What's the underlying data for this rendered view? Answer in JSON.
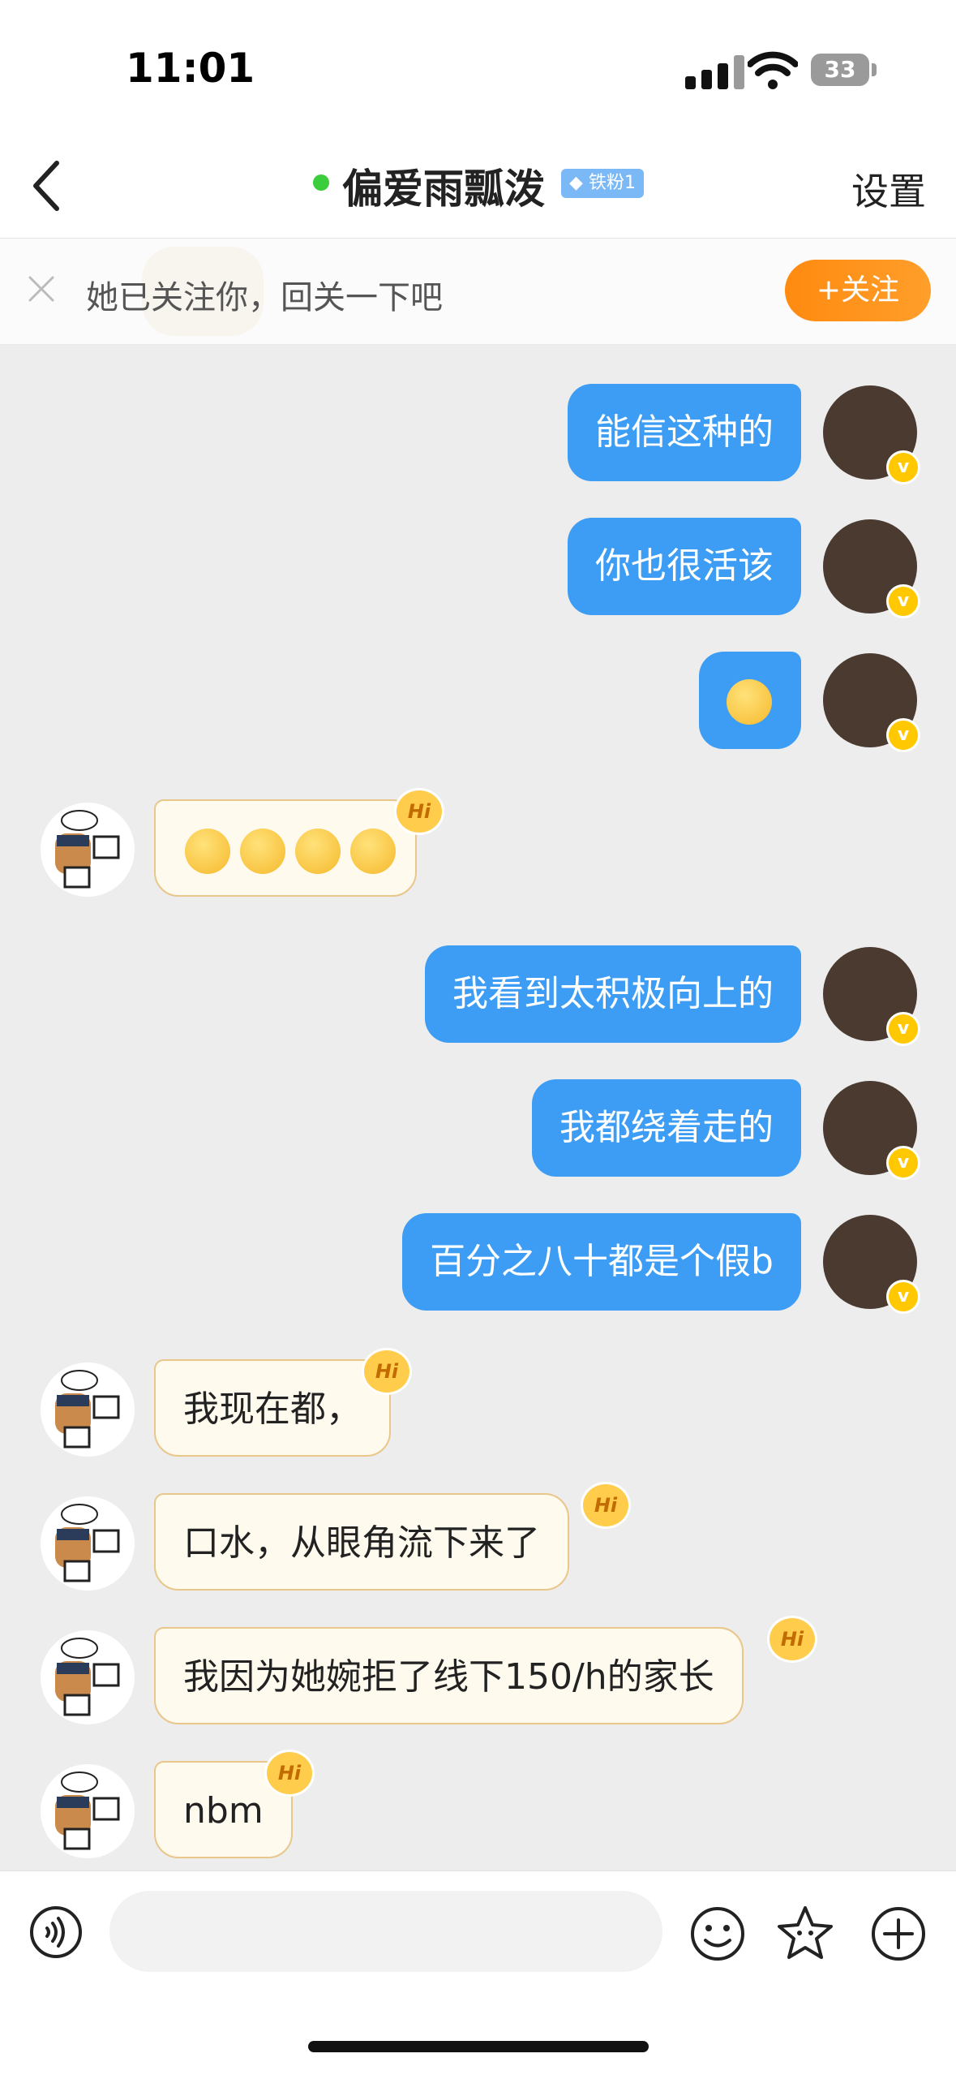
{
  "status_bar": {
    "time": "11:01",
    "battery": "33"
  },
  "nav": {
    "title": "偏爱雨瓢泼",
    "fan_badge": "铁粉1",
    "settings_label": "设置"
  },
  "banner": {
    "text": "她已关注你，回关一下吧",
    "follow_label": "+关注"
  },
  "messages": [
    {
      "from": "me",
      "text": "能信这种的"
    },
    {
      "from": "me",
      "text": "你也很活该"
    },
    {
      "from": "me",
      "text": "",
      "emoji": "crying-face-emoji"
    },
    {
      "from": "them",
      "text": "",
      "emoji": "sleepy-face-emoji x4"
    },
    {
      "from": "me",
      "text": "我看到太积极向上的"
    },
    {
      "from": "me",
      "text": "我都绕着走的"
    },
    {
      "from": "me",
      "text": "百分之八十都是个假b"
    },
    {
      "from": "them",
      "text": "我现在都，"
    },
    {
      "from": "them",
      "text": "口水，从眼角流下来了"
    },
    {
      "from": "them",
      "text": "我因为她婉拒了线下150/h的家长"
    },
    {
      "from": "them",
      "text": "nbm"
    }
  ],
  "badges": {
    "hi": "Hi",
    "verified": "v"
  },
  "input": {
    "placeholder": ""
  },
  "colors": {
    "accent_blue": "#3d9df4",
    "follow_orange": "#ff8a10",
    "online_green": "#3ccd3c",
    "their_bubble": "#fffaee"
  }
}
